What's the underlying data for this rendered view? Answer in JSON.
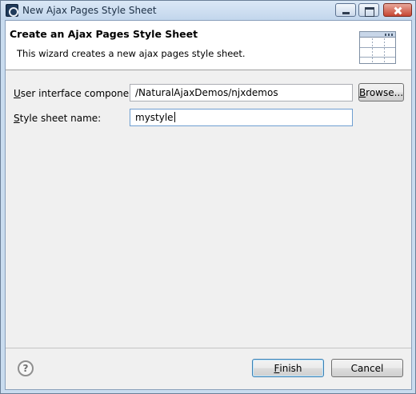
{
  "window": {
    "title": "New Ajax Pages Style Sheet",
    "app_icon": "eclipse-icon",
    "controls": [
      "minimize-icon",
      "maximize-icon",
      "close-icon"
    ]
  },
  "banner": {
    "title": "Create an Ajax Pages Style Sheet",
    "description": "This wizard creates a new ajax pages style sheet.",
    "icon": "style-sheet-wizard-icon"
  },
  "form": {
    "ui_component": {
      "label": "User interface component:",
      "mnemonic": "U",
      "value": "/NaturalAjaxDemos/njxdemos"
    },
    "browse_label": "Browse...",
    "style_sheet": {
      "label": "Style sheet name:",
      "mnemonic": "S",
      "value": "mystyle"
    }
  },
  "footer": {
    "help_icon": "help-icon",
    "finish_label": "Finish",
    "cancel_label": "Cancel"
  },
  "colors": {
    "titlebar": "#c9dcef",
    "dialog_bg": "#f0f0f0",
    "focus_border": "#6e9ed1"
  }
}
